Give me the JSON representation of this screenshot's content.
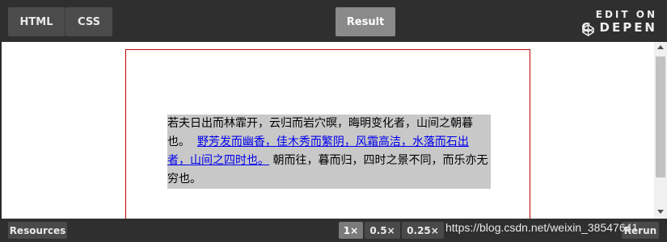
{
  "topbar": {
    "tabs": [
      "HTML",
      "CSS"
    ],
    "result_tab": "Result",
    "edit_on": "EDIT ON",
    "codepen": "C DEPEN"
  },
  "preview": {
    "text_before": "若夫日出而林霏开，云归而岩穴暝，晦明变化者，山间之朝暮也。",
    "link_text": "野芳发而幽香，佳木秀而繁阴，风霜高洁，水落而石出者，山间之四时也。",
    "text_after": "朝而往，暮而归，四时之景不同，而乐亦无穷也。"
  },
  "bottombar": {
    "resources": "Resources",
    "zoom_levels": [
      "1×",
      "0.5×",
      "0.25×"
    ],
    "rerun": "Rerun",
    "watermark": "https://blog.csdn.net/weixin_38547641"
  },
  "colors": {
    "link": "#0000ee",
    "highlight": "#c8c8c8",
    "preview_border": "#c40000"
  }
}
